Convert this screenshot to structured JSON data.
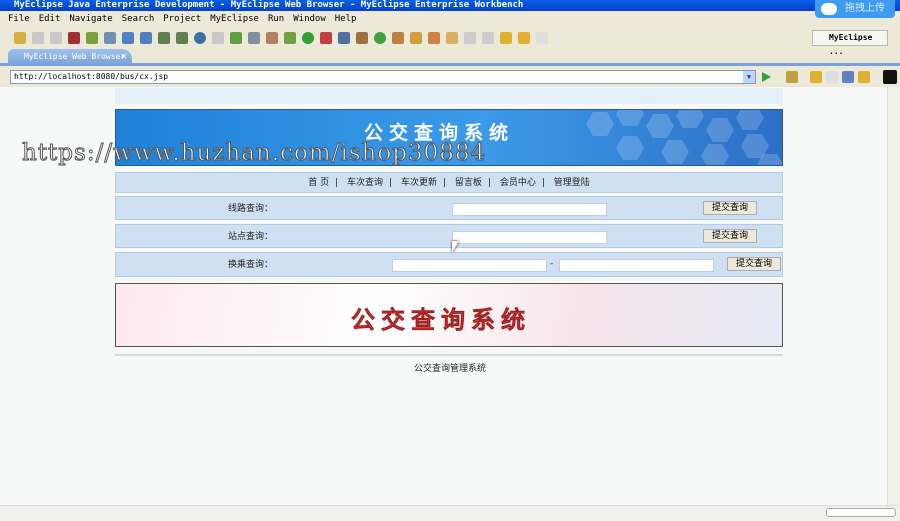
{
  "window": {
    "title": "MyEclipse Java Enterprise Development - MyEclipse Web Browser - MyEclipse Enterprise Workbench",
    "upload_label": "拖拽上传"
  },
  "menu": [
    "File",
    "Edit",
    "Navigate",
    "Search",
    "Project",
    "MyEclipse",
    "Run",
    "Window",
    "Help"
  ],
  "perspective": "MyEclipse ...",
  "tab": {
    "label": "MyEclipse Web Browser",
    "close": "✕"
  },
  "address": {
    "url": "http://localhost:8080/bus/cx.jsp"
  },
  "site": {
    "banner_title": "公交查询系统",
    "watermark": "https://www.huzhan.com/ishop30884",
    "nav": [
      "首 页",
      "车次查询",
      "车次更新",
      "留言板",
      "会员中心",
      "管理登陆"
    ],
    "nav_sep": "|",
    "route_label": "线路查询：",
    "station_label": "站点查询：",
    "transfer_label": "换乘查询：",
    "transfer_sep": "-",
    "submit": "提交查询",
    "banner2_title": "公交查询系统",
    "footer": "公交查询管理系统"
  }
}
